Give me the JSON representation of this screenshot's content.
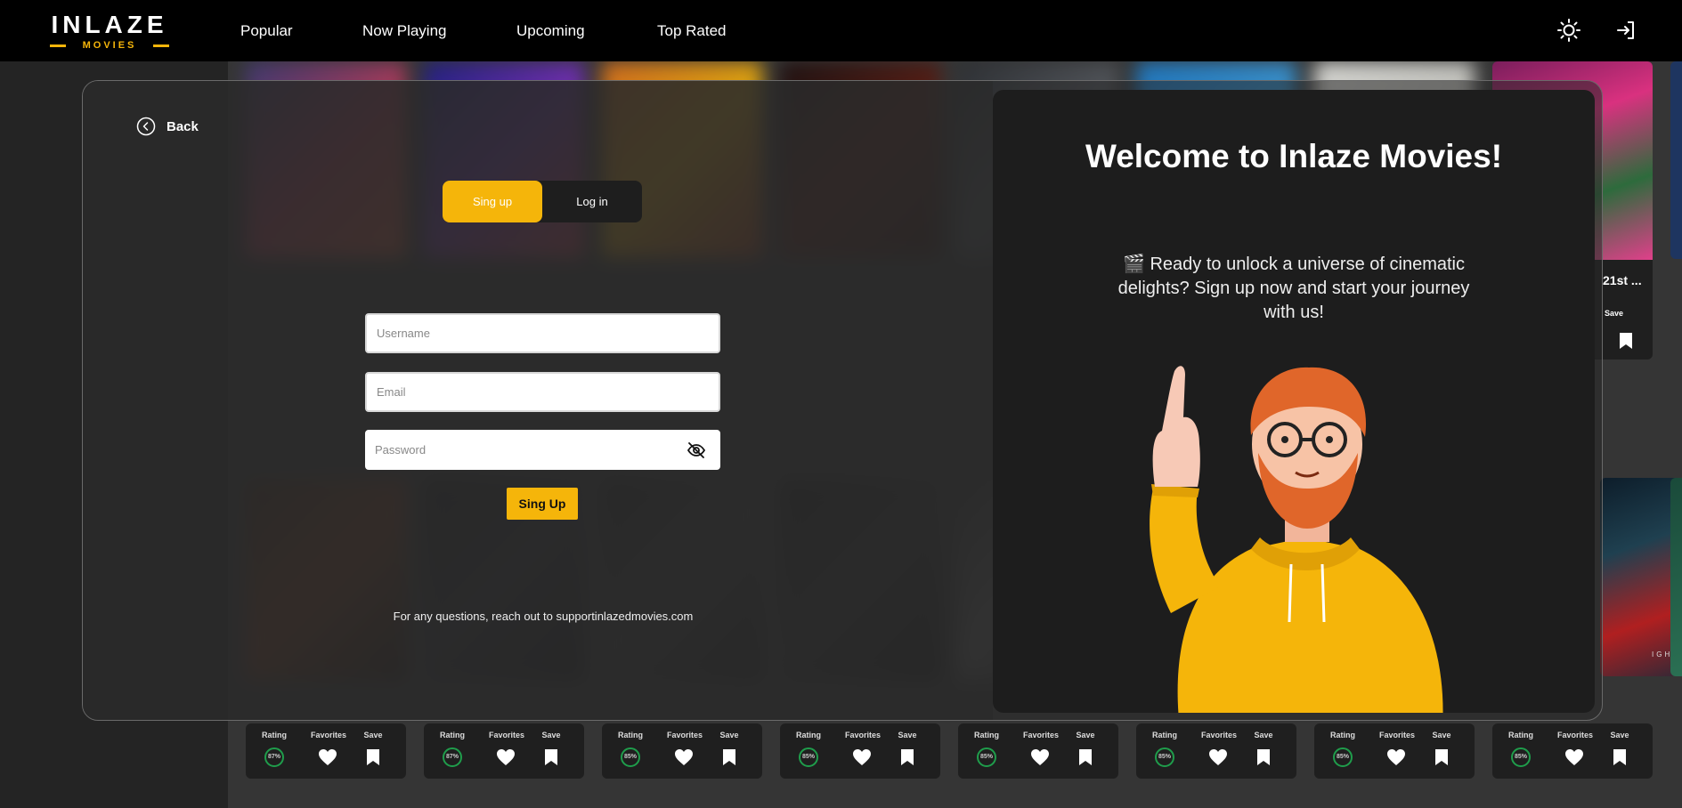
{
  "brand": {
    "name": "INLAZE",
    "sub": "MOVIES",
    "accent": "#f5b50a"
  },
  "nav": {
    "links": [
      "Popular",
      "Now Playing",
      "Upcoming",
      "Top Rated"
    ],
    "theme_icon": "sun-icon",
    "login_icon": "login-icon"
  },
  "background": {
    "top_cards": [
      {
        "title": "",
        "save_label": "Save"
      },
      {
        "title": "21st ...",
        "save_label": "Save"
      }
    ],
    "card_labels": {
      "rating": "Rating",
      "favorites": "Favorites",
      "save": "Save"
    },
    "bottom_ratings": [
      "87%",
      "87%",
      "85%",
      "85%",
      "85%",
      "85%",
      "85%",
      "85%"
    ],
    "poster_text": "IGHT",
    "rating_color": "#1f9d4b"
  },
  "modal": {
    "back_label": "Back",
    "tabs": {
      "signup": "Sing up",
      "login": "Log in"
    },
    "fields": {
      "username_placeholder": "Username",
      "email_placeholder": "Email",
      "password_placeholder": "Password"
    },
    "submit_label": "Sing Up",
    "footnote": "For any questions, reach out to supportinlazedmovies.com",
    "welcome_title": "Welcome to Inlaze Movies!",
    "pitch": "🎬 Ready to unlock a universe of cinematic delights? Sign up now and start your journey with us!"
  }
}
